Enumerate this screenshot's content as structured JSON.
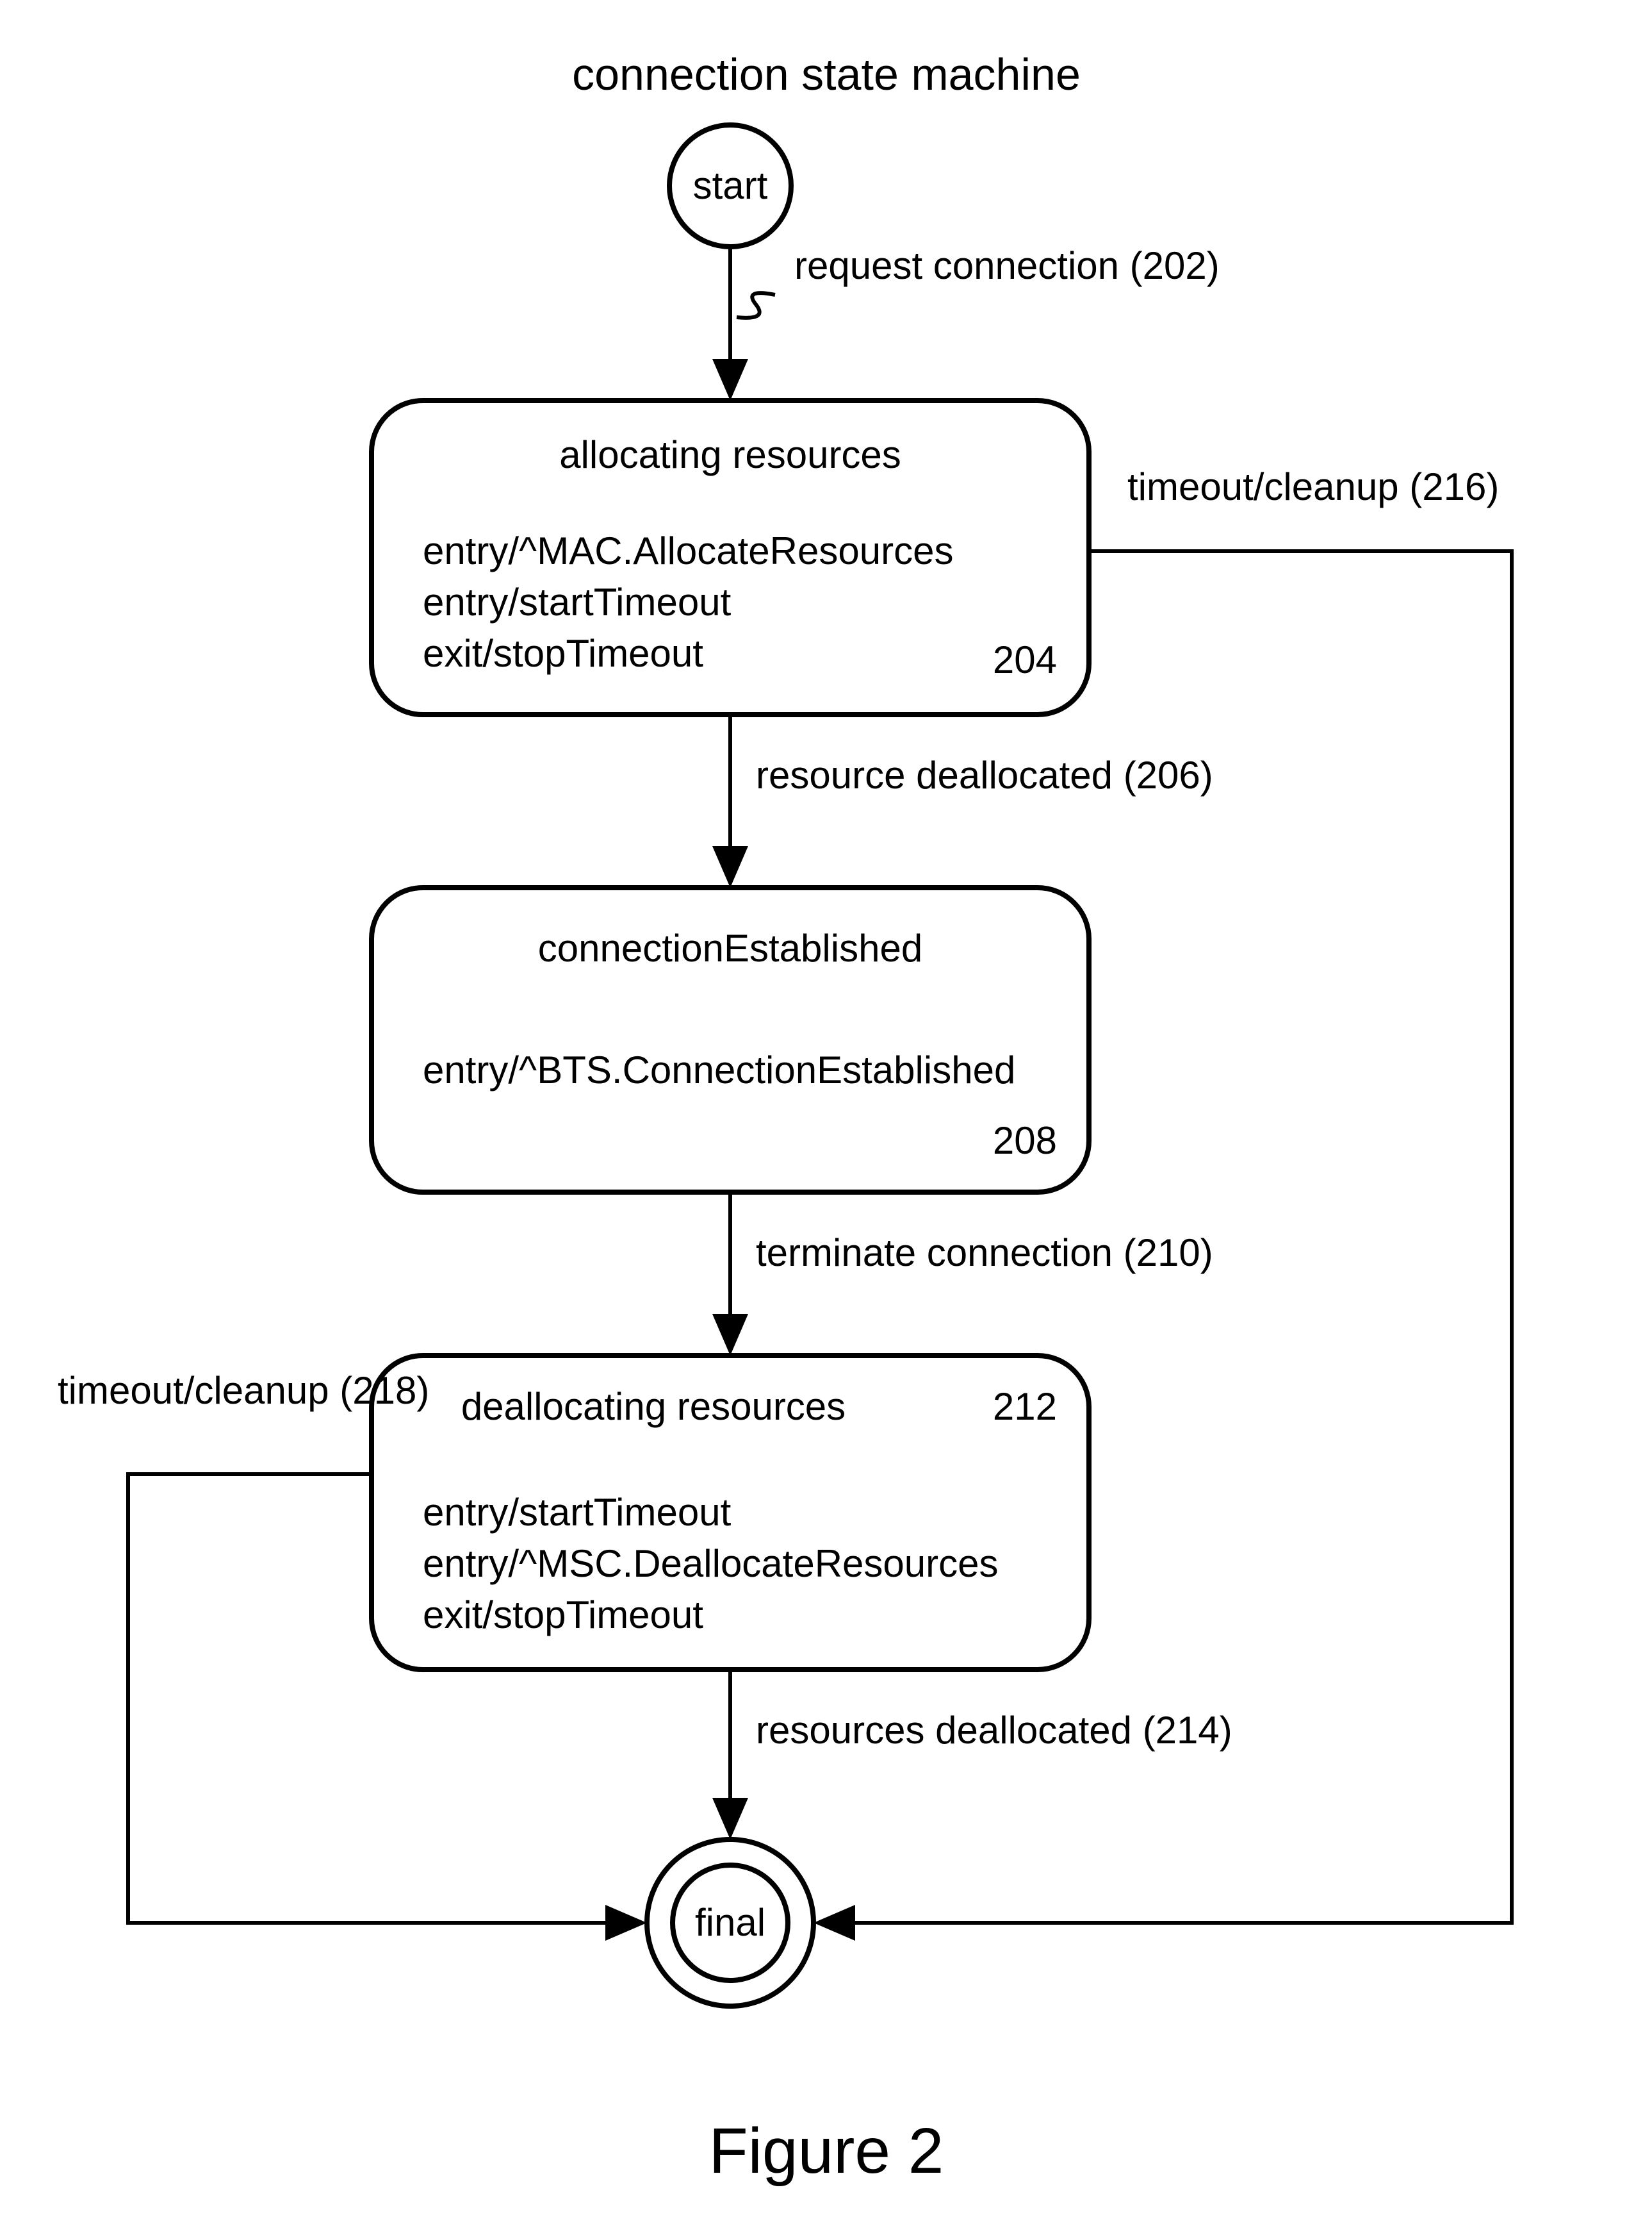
{
  "diagram": {
    "title": "connection state machine",
    "figure_caption": "Figure 2",
    "nodes": {
      "start": {
        "label": "start"
      },
      "final": {
        "label": "final"
      },
      "allocating": {
        "title": "allocating resources",
        "actions": [
          "entry/^MAC.AllocateResources",
          "entry/startTimeout",
          "exit/stopTimeout"
        ],
        "ref": "204"
      },
      "established": {
        "title": "connectionEstablished",
        "actions": [
          "entry/^BTS.ConnectionEstablished"
        ],
        "ref": "208"
      },
      "deallocating": {
        "title": "deallocating resources",
        "actions": [
          "entry/startTimeout",
          "entry/^MSC.DeallocateResources",
          "exit/stopTimeout"
        ],
        "ref": "212"
      }
    },
    "transitions": {
      "request_connection": "request connection (202)",
      "resource_deallocated": "resource deallocated (206)",
      "terminate_connection": "terminate connection (210)",
      "resources_deallocated": "resources deallocated (214)",
      "timeout_top": "timeout/cleanup (216)",
      "timeout_bottom": "timeout/cleanup (218)"
    }
  }
}
